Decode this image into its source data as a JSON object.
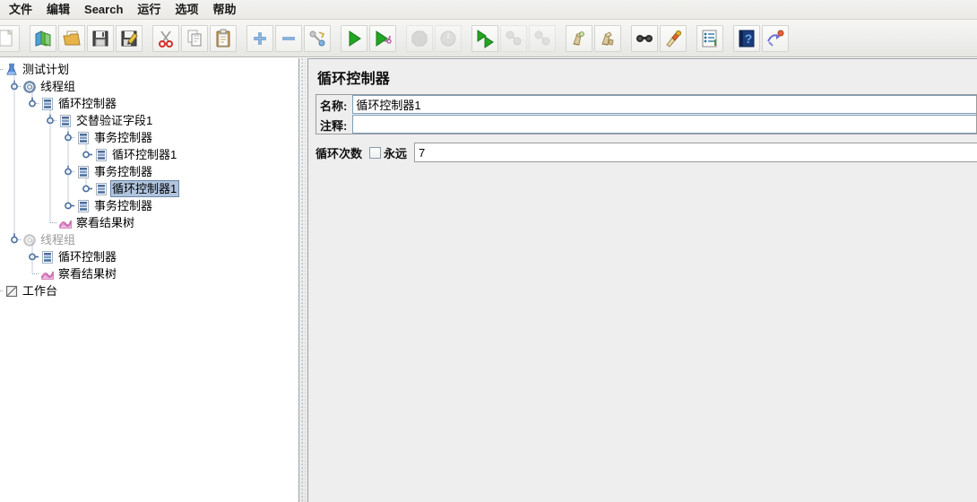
{
  "menubar": {
    "items": [
      {
        "label": "文件",
        "name": "menu-file"
      },
      {
        "label": "编辑",
        "name": "menu-edit"
      },
      {
        "label": "Search",
        "name": "menu-search"
      },
      {
        "label": "运行",
        "name": "menu-run"
      },
      {
        "label": "选项",
        "name": "menu-options"
      },
      {
        "label": "帮助",
        "name": "menu-help"
      }
    ]
  },
  "toolbar": {
    "buttons": [
      {
        "icon": "new-document-icon",
        "enabled": true
      },
      {
        "icon": "open-templates-icon",
        "enabled": true
      },
      {
        "icon": "open-folder-icon",
        "enabled": true
      },
      {
        "icon": "save-icon",
        "enabled": true
      },
      {
        "icon": "save-as-icon",
        "enabled": true
      },
      {
        "icon": "cut-icon",
        "enabled": true
      },
      {
        "icon": "copy-icon",
        "enabled": true
      },
      {
        "icon": "paste-icon",
        "enabled": true
      },
      {
        "icon": "expand-all-icon",
        "enabled": true
      },
      {
        "icon": "collapse-all-icon",
        "enabled": true
      },
      {
        "icon": "toggle-icon",
        "enabled": true
      },
      {
        "icon": "start-icon",
        "enabled": true
      },
      {
        "icon": "start-no-pauses-icon",
        "enabled": true
      },
      {
        "icon": "stop-icon",
        "enabled": false
      },
      {
        "icon": "shutdown-icon",
        "enabled": false
      },
      {
        "icon": "start-remote-all-icon",
        "enabled": true
      },
      {
        "icon": "stop-remote-all-icon",
        "enabled": false
      },
      {
        "icon": "shutdown-remote-all-icon",
        "enabled": false
      },
      {
        "icon": "clear-icon",
        "enabled": true
      },
      {
        "icon": "clear-all-icon",
        "enabled": true
      },
      {
        "icon": "search-icon",
        "enabled": true
      },
      {
        "icon": "search-reset-icon",
        "enabled": true
      },
      {
        "icon": "function-helper-icon",
        "enabled": true
      },
      {
        "icon": "help-icon",
        "enabled": true
      },
      {
        "icon": "undo-redo-icon",
        "enabled": true
      }
    ]
  },
  "tree": {
    "nodes": [
      {
        "label": "测试计划",
        "depth": 0,
        "icon": "test-plan-icon",
        "handle": "expanded",
        "selected": false,
        "disabled": false
      },
      {
        "label": "线程组",
        "depth": 1,
        "icon": "thread-group-icon",
        "handle": "expanded",
        "selected": false,
        "disabled": false
      },
      {
        "label": "循环控制器",
        "depth": 2,
        "icon": "controller-icon",
        "handle": "expanded",
        "selected": false,
        "disabled": false
      },
      {
        "label": "交替验证字段1",
        "depth": 3,
        "icon": "controller-icon",
        "handle": "expanded",
        "selected": false,
        "disabled": false
      },
      {
        "label": "事务控制器",
        "depth": 4,
        "icon": "controller-icon",
        "handle": "expanded",
        "selected": false,
        "disabled": false
      },
      {
        "label": "循环控制器1",
        "depth": 5,
        "icon": "controller-icon",
        "handle": "collapsed",
        "selected": false,
        "disabled": false
      },
      {
        "label": "事务控制器",
        "depth": 4,
        "icon": "controller-icon",
        "handle": "expanded",
        "selected": false,
        "disabled": false
      },
      {
        "label": "循环控制器1",
        "depth": 5,
        "icon": "controller-icon",
        "handle": "collapsed",
        "selected": true,
        "disabled": false
      },
      {
        "label": "事务控制器",
        "depth": 4,
        "icon": "controller-icon",
        "handle": "collapsed",
        "selected": false,
        "disabled": false
      },
      {
        "label": "察看结果树",
        "depth": 3,
        "icon": "view-results-tree-icon",
        "handle": "none",
        "selected": false,
        "disabled": false
      },
      {
        "label": "线程组",
        "depth": 1,
        "icon": "thread-group-icon",
        "handle": "expanded",
        "selected": false,
        "disabled": true
      },
      {
        "label": "循环控制器",
        "depth": 2,
        "icon": "controller-icon",
        "handle": "collapsed",
        "selected": false,
        "disabled": false
      },
      {
        "label": "察看结果树",
        "depth": 2,
        "icon": "view-results-tree-icon",
        "handle": "none",
        "selected": false,
        "disabled": false
      },
      {
        "label": "工作台",
        "depth": 0,
        "icon": "workbench-icon",
        "handle": "none",
        "selected": false,
        "disabled": false
      }
    ]
  },
  "panel": {
    "title": "循环控制器",
    "name_label": "名称:",
    "name_value": "循环控制器1",
    "comment_label": "注释:",
    "comment_value": "",
    "loops_label": "循环次数",
    "forever_label": "永远",
    "forever_checked": false,
    "loops_value": "7"
  },
  "colors": {
    "selection": "#b0c4de",
    "selection_border": "#6e86a8",
    "panel_bg": "#eeeeee",
    "field_border": "#7f9db9",
    "toolbar_bg": "#eeeeec"
  }
}
